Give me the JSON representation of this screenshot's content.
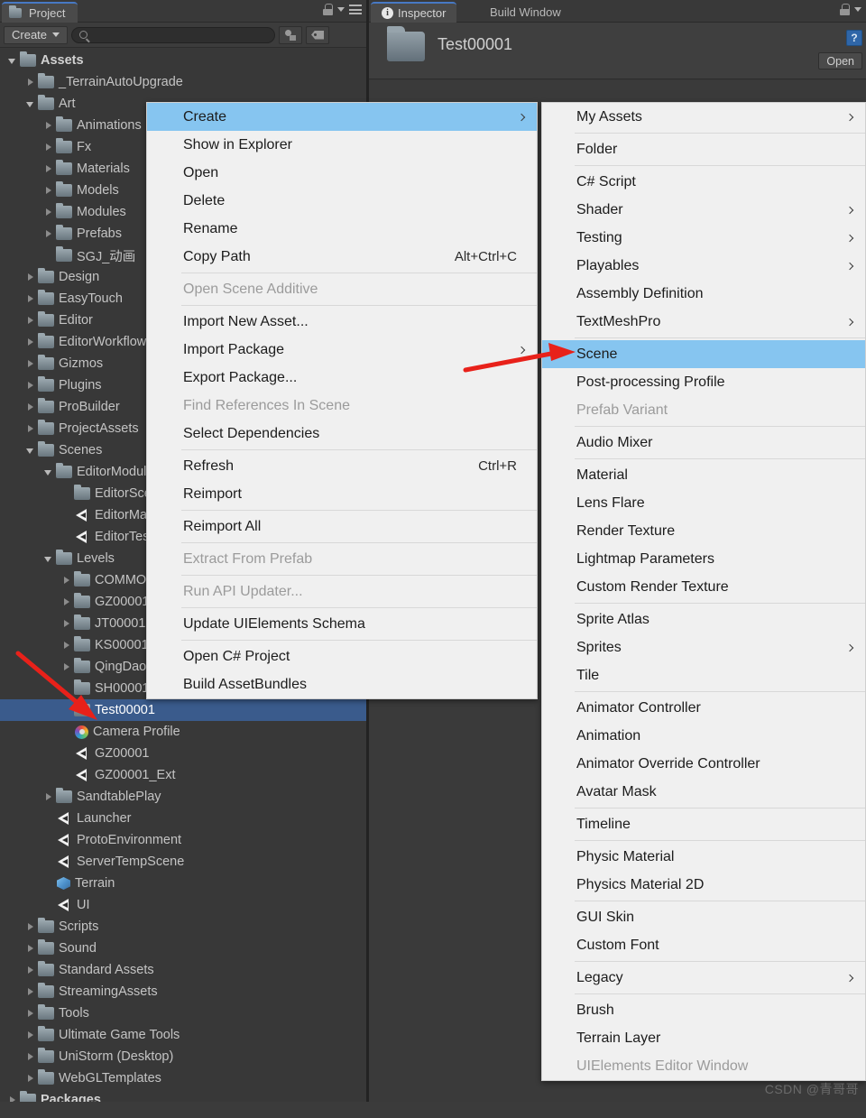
{
  "project_panel": {
    "tab_label": "Project",
    "create_button": "Create",
    "search_placeholder": "",
    "search_value": "",
    "icons": {
      "project_tab_icon": "folder-icon",
      "lock": "lock-icon",
      "menu": "hamburger-icon",
      "filter_type": "filter-by-type-icon",
      "filter_label": "filter-by-label-icon",
      "search": "search-icon"
    },
    "tree": [
      {
        "label": "Assets",
        "depth": 0,
        "icon": "folder",
        "state": "open",
        "bold": true
      },
      {
        "label": "_TerrainAutoUpgrade",
        "depth": 1,
        "icon": "folder",
        "state": "closed"
      },
      {
        "label": "Art",
        "depth": 1,
        "icon": "folder",
        "state": "open"
      },
      {
        "label": "Animations",
        "depth": 2,
        "icon": "folder",
        "state": "closed"
      },
      {
        "label": "Fx",
        "depth": 2,
        "icon": "folder",
        "state": "closed"
      },
      {
        "label": "Materials",
        "depth": 2,
        "icon": "folder",
        "state": "closed"
      },
      {
        "label": "Models",
        "depth": 2,
        "icon": "folder",
        "state": "closed"
      },
      {
        "label": "Modules",
        "depth": 2,
        "icon": "folder",
        "state": "closed"
      },
      {
        "label": "Prefabs",
        "depth": 2,
        "icon": "folder",
        "state": "closed"
      },
      {
        "label": "SGJ_动画",
        "depth": 2,
        "icon": "folder",
        "state": "leaf"
      },
      {
        "label": "Design",
        "depth": 1,
        "icon": "folder",
        "state": "closed"
      },
      {
        "label": "EasyTouch",
        "depth": 1,
        "icon": "folder",
        "state": "closed"
      },
      {
        "label": "Editor",
        "depth": 1,
        "icon": "folder",
        "state": "closed"
      },
      {
        "label": "EditorWorkflow",
        "depth": 1,
        "icon": "folder",
        "state": "closed"
      },
      {
        "label": "Gizmos",
        "depth": 1,
        "icon": "folder",
        "state": "closed"
      },
      {
        "label": "Plugins",
        "depth": 1,
        "icon": "folder",
        "state": "closed"
      },
      {
        "label": "ProBuilder",
        "depth": 1,
        "icon": "folder",
        "state": "closed"
      },
      {
        "label": "ProjectAssets",
        "depth": 1,
        "icon": "folder",
        "state": "closed"
      },
      {
        "label": "Scenes",
        "depth": 1,
        "icon": "folder",
        "state": "open"
      },
      {
        "label": "EditorModule",
        "depth": 2,
        "icon": "folder",
        "state": "open"
      },
      {
        "label": "EditorScene",
        "depth": 3,
        "icon": "folder",
        "state": "leaf"
      },
      {
        "label": "EditorMain",
        "depth": 3,
        "icon": "unity",
        "state": "leaf"
      },
      {
        "label": "EditorTest",
        "depth": 3,
        "icon": "unity",
        "state": "leaf"
      },
      {
        "label": "Levels",
        "depth": 2,
        "icon": "folder",
        "state": "open"
      },
      {
        "label": "COMMON",
        "depth": 3,
        "icon": "folder",
        "state": "closed"
      },
      {
        "label": "GZ00001",
        "depth": 3,
        "icon": "folder",
        "state": "closed"
      },
      {
        "label": "JT00001",
        "depth": 3,
        "icon": "folder",
        "state": "closed"
      },
      {
        "label": "KS00001",
        "depth": 3,
        "icon": "folder",
        "state": "closed"
      },
      {
        "label": "QingDao",
        "depth": 3,
        "icon": "folder",
        "state": "closed"
      },
      {
        "label": "SH00001",
        "depth": 3,
        "icon": "folder",
        "state": "leaf"
      },
      {
        "label": "Test00001",
        "depth": 3,
        "icon": "folder",
        "state": "leaf",
        "selected": true
      },
      {
        "label": "Camera Profile",
        "depth": 3,
        "icon": "camera",
        "state": "leaf"
      },
      {
        "label": "GZ00001",
        "depth": 3,
        "icon": "unity",
        "state": "leaf"
      },
      {
        "label": "GZ00001_Ext",
        "depth": 3,
        "icon": "unity",
        "state": "leaf"
      },
      {
        "label": "SandtablePlay",
        "depth": 2,
        "icon": "folder",
        "state": "closed"
      },
      {
        "label": "Launcher",
        "depth": 2,
        "icon": "unity",
        "state": "leaf"
      },
      {
        "label": "ProtoEnvironment",
        "depth": 2,
        "icon": "unity",
        "state": "leaf"
      },
      {
        "label": "ServerTempScene",
        "depth": 2,
        "icon": "unity",
        "state": "leaf"
      },
      {
        "label": "Terrain",
        "depth": 2,
        "icon": "cube",
        "state": "leaf"
      },
      {
        "label": "UI",
        "depth": 2,
        "icon": "unity",
        "state": "leaf"
      },
      {
        "label": "Scripts",
        "depth": 1,
        "icon": "folder",
        "state": "closed"
      },
      {
        "label": "Sound",
        "depth": 1,
        "icon": "folder",
        "state": "closed"
      },
      {
        "label": "Standard Assets",
        "depth": 1,
        "icon": "folder",
        "state": "closed"
      },
      {
        "label": "StreamingAssets",
        "depth": 1,
        "icon": "folder",
        "state": "closed"
      },
      {
        "label": "Tools",
        "depth": 1,
        "icon": "folder",
        "state": "closed"
      },
      {
        "label": "Ultimate Game Tools",
        "depth": 1,
        "icon": "folder",
        "state": "closed"
      },
      {
        "label": "UniStorm (Desktop)",
        "depth": 1,
        "icon": "folder",
        "state": "closed"
      },
      {
        "label": "WebGLTemplates",
        "depth": 1,
        "icon": "folder",
        "state": "closed"
      },
      {
        "label": "Packages",
        "depth": 0,
        "icon": "folder",
        "state": "closed",
        "bold": true
      }
    ]
  },
  "inspector_panel": {
    "tab_active": "Inspector",
    "tab_inactive": "Build Window",
    "asset_name": "Test00001",
    "open_button": "Open",
    "help_icon": "?",
    "icons": {
      "inspector_tab_icon": "info-icon",
      "asset_icon": "folder-icon",
      "help": "help-icon",
      "lock": "lock-icon"
    }
  },
  "context_menu": {
    "items": [
      {
        "label": "Create",
        "highlight": true,
        "submenu": true
      },
      {
        "label": "Show in Explorer"
      },
      {
        "label": "Open"
      },
      {
        "label": "Delete"
      },
      {
        "label": "Rename"
      },
      {
        "label": "Copy Path",
        "shortcut": "Alt+Ctrl+C"
      },
      {
        "separator": true
      },
      {
        "label": "Open Scene Additive",
        "disabled": true
      },
      {
        "separator": true
      },
      {
        "label": "Import New Asset..."
      },
      {
        "label": "Import Package",
        "submenu": true
      },
      {
        "label": "Export Package..."
      },
      {
        "label": "Find References In Scene",
        "disabled": true
      },
      {
        "label": "Select Dependencies"
      },
      {
        "separator": true
      },
      {
        "label": "Refresh",
        "shortcut": "Ctrl+R"
      },
      {
        "label": "Reimport"
      },
      {
        "separator": true
      },
      {
        "label": "Reimport All"
      },
      {
        "separator": true
      },
      {
        "label": "Extract From Prefab",
        "disabled": true
      },
      {
        "separator": true
      },
      {
        "label": "Run API Updater...",
        "disabled": true
      },
      {
        "separator": true
      },
      {
        "label": "Update UIElements Schema"
      },
      {
        "separator": true
      },
      {
        "label": "Open C# Project"
      },
      {
        "label": "Build AssetBundles"
      }
    ]
  },
  "create_submenu": {
    "items": [
      {
        "label": "My Assets",
        "submenu": true
      },
      {
        "separator": true
      },
      {
        "label": "Folder"
      },
      {
        "separator": true
      },
      {
        "label": "C# Script"
      },
      {
        "label": "Shader",
        "submenu": true
      },
      {
        "label": "Testing",
        "submenu": true
      },
      {
        "label": "Playables",
        "submenu": true
      },
      {
        "label": "Assembly Definition"
      },
      {
        "label": "TextMeshPro",
        "submenu": true
      },
      {
        "separator": true
      },
      {
        "label": "Scene",
        "highlight": true
      },
      {
        "label": "Post-processing Profile"
      },
      {
        "label": "Prefab Variant",
        "disabled": true
      },
      {
        "separator": true
      },
      {
        "label": "Audio Mixer"
      },
      {
        "separator": true
      },
      {
        "label": "Material"
      },
      {
        "label": "Lens Flare"
      },
      {
        "label": "Render Texture"
      },
      {
        "label": "Lightmap Parameters"
      },
      {
        "label": "Custom Render Texture"
      },
      {
        "separator": true
      },
      {
        "label": "Sprite Atlas"
      },
      {
        "label": "Sprites",
        "submenu": true
      },
      {
        "label": "Tile"
      },
      {
        "separator": true
      },
      {
        "label": "Animator Controller"
      },
      {
        "label": "Animation"
      },
      {
        "label": "Animator Override Controller"
      },
      {
        "label": "Avatar Mask"
      },
      {
        "separator": true
      },
      {
        "label": "Timeline"
      },
      {
        "separator": true
      },
      {
        "label": "Physic Material"
      },
      {
        "label": "Physics Material 2D"
      },
      {
        "separator": true
      },
      {
        "label": "GUI Skin"
      },
      {
        "label": "Custom Font"
      },
      {
        "separator": true
      },
      {
        "label": "Legacy",
        "submenu": true
      },
      {
        "separator": true
      },
      {
        "label": "Brush"
      },
      {
        "label": "Terrain Layer"
      },
      {
        "label": "UIElements Editor Window",
        "disabled": true
      }
    ]
  },
  "annotations": {
    "arrow_color": "#e8211a",
    "watermark": "CSDN @青哥哥"
  },
  "colors": {
    "panel_bg": "#383838",
    "menu_bg": "#f0f0f0",
    "menu_highlight": "#86c5f0",
    "tree_selected": "#3a5b8c",
    "tab_accent": "#4779c4"
  }
}
